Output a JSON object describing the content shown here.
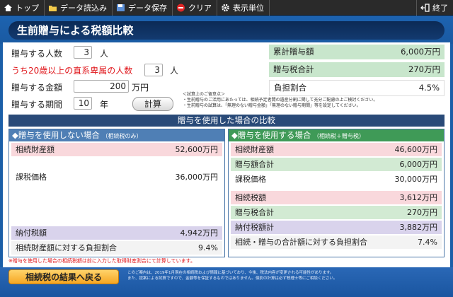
{
  "toolbar": {
    "top": "トップ",
    "load": "データ読込み",
    "save": "データ保存",
    "clear": "クリア",
    "units": "表示単位",
    "exit": "終了"
  },
  "title": "生前贈与による税額比較",
  "inputs": {
    "num_recipients_label": "贈与する人数",
    "num_recipients": "3",
    "num_recipients_unit": "人",
    "under20_label": "うち20歳以上の直系卑属の人数",
    "under20": "3",
    "under20_unit": "人",
    "amount_label": "贈与する金額",
    "amount": "200",
    "amount_unit": "万円",
    "period_label": "贈与する期間",
    "period": "10",
    "period_unit": "年",
    "calc_button": "計算"
  },
  "summary": {
    "cumulative_label": "累計贈与額",
    "cumulative_value": "6,000万円",
    "gifttax_label": "贈与税合計",
    "gifttax_value": "270万円",
    "burden_label": "負担割合",
    "burden_value": "4.5%"
  },
  "notes": [
    "＜試算上のご留意点＞",
    "・生前贈与のご活用にあたっては、相続予定者間の遺産分割に関して充分ご配慮の上ご検討ください。",
    "・生前贈与の試算は、「無理のない贈与金額」「無理のない贈与期間」等を設定してください。"
  ],
  "comparison_header": "贈与を使用した場合の比較",
  "left_panel": {
    "title": "◆贈与を使用しない場合",
    "subtitle": "（相続税のみ）",
    "estate_label": "相続財産額",
    "estate_value": "52,600万円",
    "taxable_label": "課税価格",
    "taxable_value": "36,000万円",
    "tax_label": "納付税額",
    "tax_value": "4,942万円",
    "ratio_label": "相続財産額に対する負担割合",
    "ratio_value": "9.4%"
  },
  "right_panel": {
    "title": "◆贈与を使用する場合",
    "subtitle": "（相続税＋贈与税）",
    "estate_label": "相続財産額",
    "estate_value": "46,600万円",
    "gift_total_label": "贈与額合計",
    "gift_total_value": "6,000万円",
    "taxable_label": "課税価格",
    "taxable_value": "30,000万円",
    "inh_tax_label": "相続税額",
    "inh_tax_value": "3,612万円",
    "gift_tax_label": "贈与税合計",
    "gift_tax_value": "270万円",
    "paid_label": "納付税額計",
    "paid_value": "3,882万円",
    "ratio_label": "相続・贈与の合計額に対する負担割合",
    "ratio_value": "7.4%"
  },
  "footnote": "※贈与を使用した場合の相続税額は前に入力した取得財産割合にて計算しています。",
  "back_button": "相続税の結果へ戻る",
  "disclaimer": [
    "このご案内は、2019年1月現在の相続税および情報に基づいており、今後、税法内容が変更される可能性があります。",
    "また、提案による試算ですので、金額等を保証するものではありません。個別の計算は必ず税理士等にご相談ください。"
  ],
  "colors": {
    "brand_blue": "#1b5fa8",
    "title_pill": "#0b2a55",
    "red_text": "#e0161b",
    "left_header": "#4f7fb5",
    "right_header": "#3f9a57"
  }
}
